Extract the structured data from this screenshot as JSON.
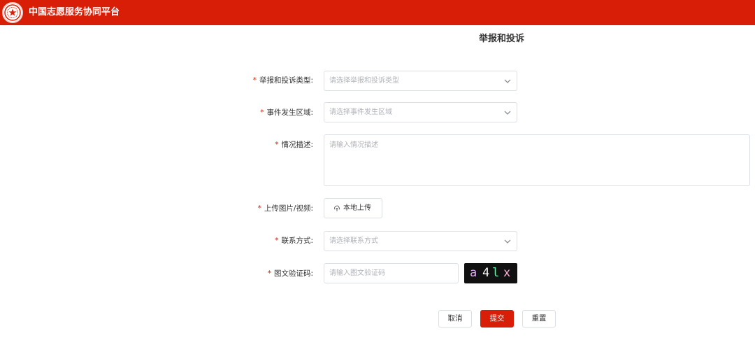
{
  "header": {
    "site_title": "中国志愿服务协同平台"
  },
  "page": {
    "title": "举报和投诉"
  },
  "form": {
    "required_mark": "*",
    "report_type": {
      "label": "举报和投诉类型:",
      "placeholder": "请选择举报和投诉类型"
    },
    "region": {
      "label": "事件发生区域:",
      "placeholder": "请选择事件发生区域"
    },
    "description": {
      "label": "情况描述:",
      "placeholder": "请输入情况描述"
    },
    "upload": {
      "label": "上传图片/视频:",
      "button": "本地上传"
    },
    "contact": {
      "label": "联系方式:",
      "placeholder": "请选择联系方式"
    },
    "captcha": {
      "label": "图文验证码:",
      "placeholder": "请输入图文验证码",
      "chars": [
        "a",
        "4",
        "l",
        "x"
      ],
      "char_colors": [
        "#e0a8ff",
        "#ffffff",
        "#6cf0a8",
        "#ffb3d9"
      ]
    }
  },
  "actions": {
    "cancel": "取消",
    "submit": "提交",
    "reset": "重置"
  },
  "colors": {
    "brand": "#d81e06",
    "border": "#dcdfe6",
    "placeholder": "#b0b3b9"
  }
}
